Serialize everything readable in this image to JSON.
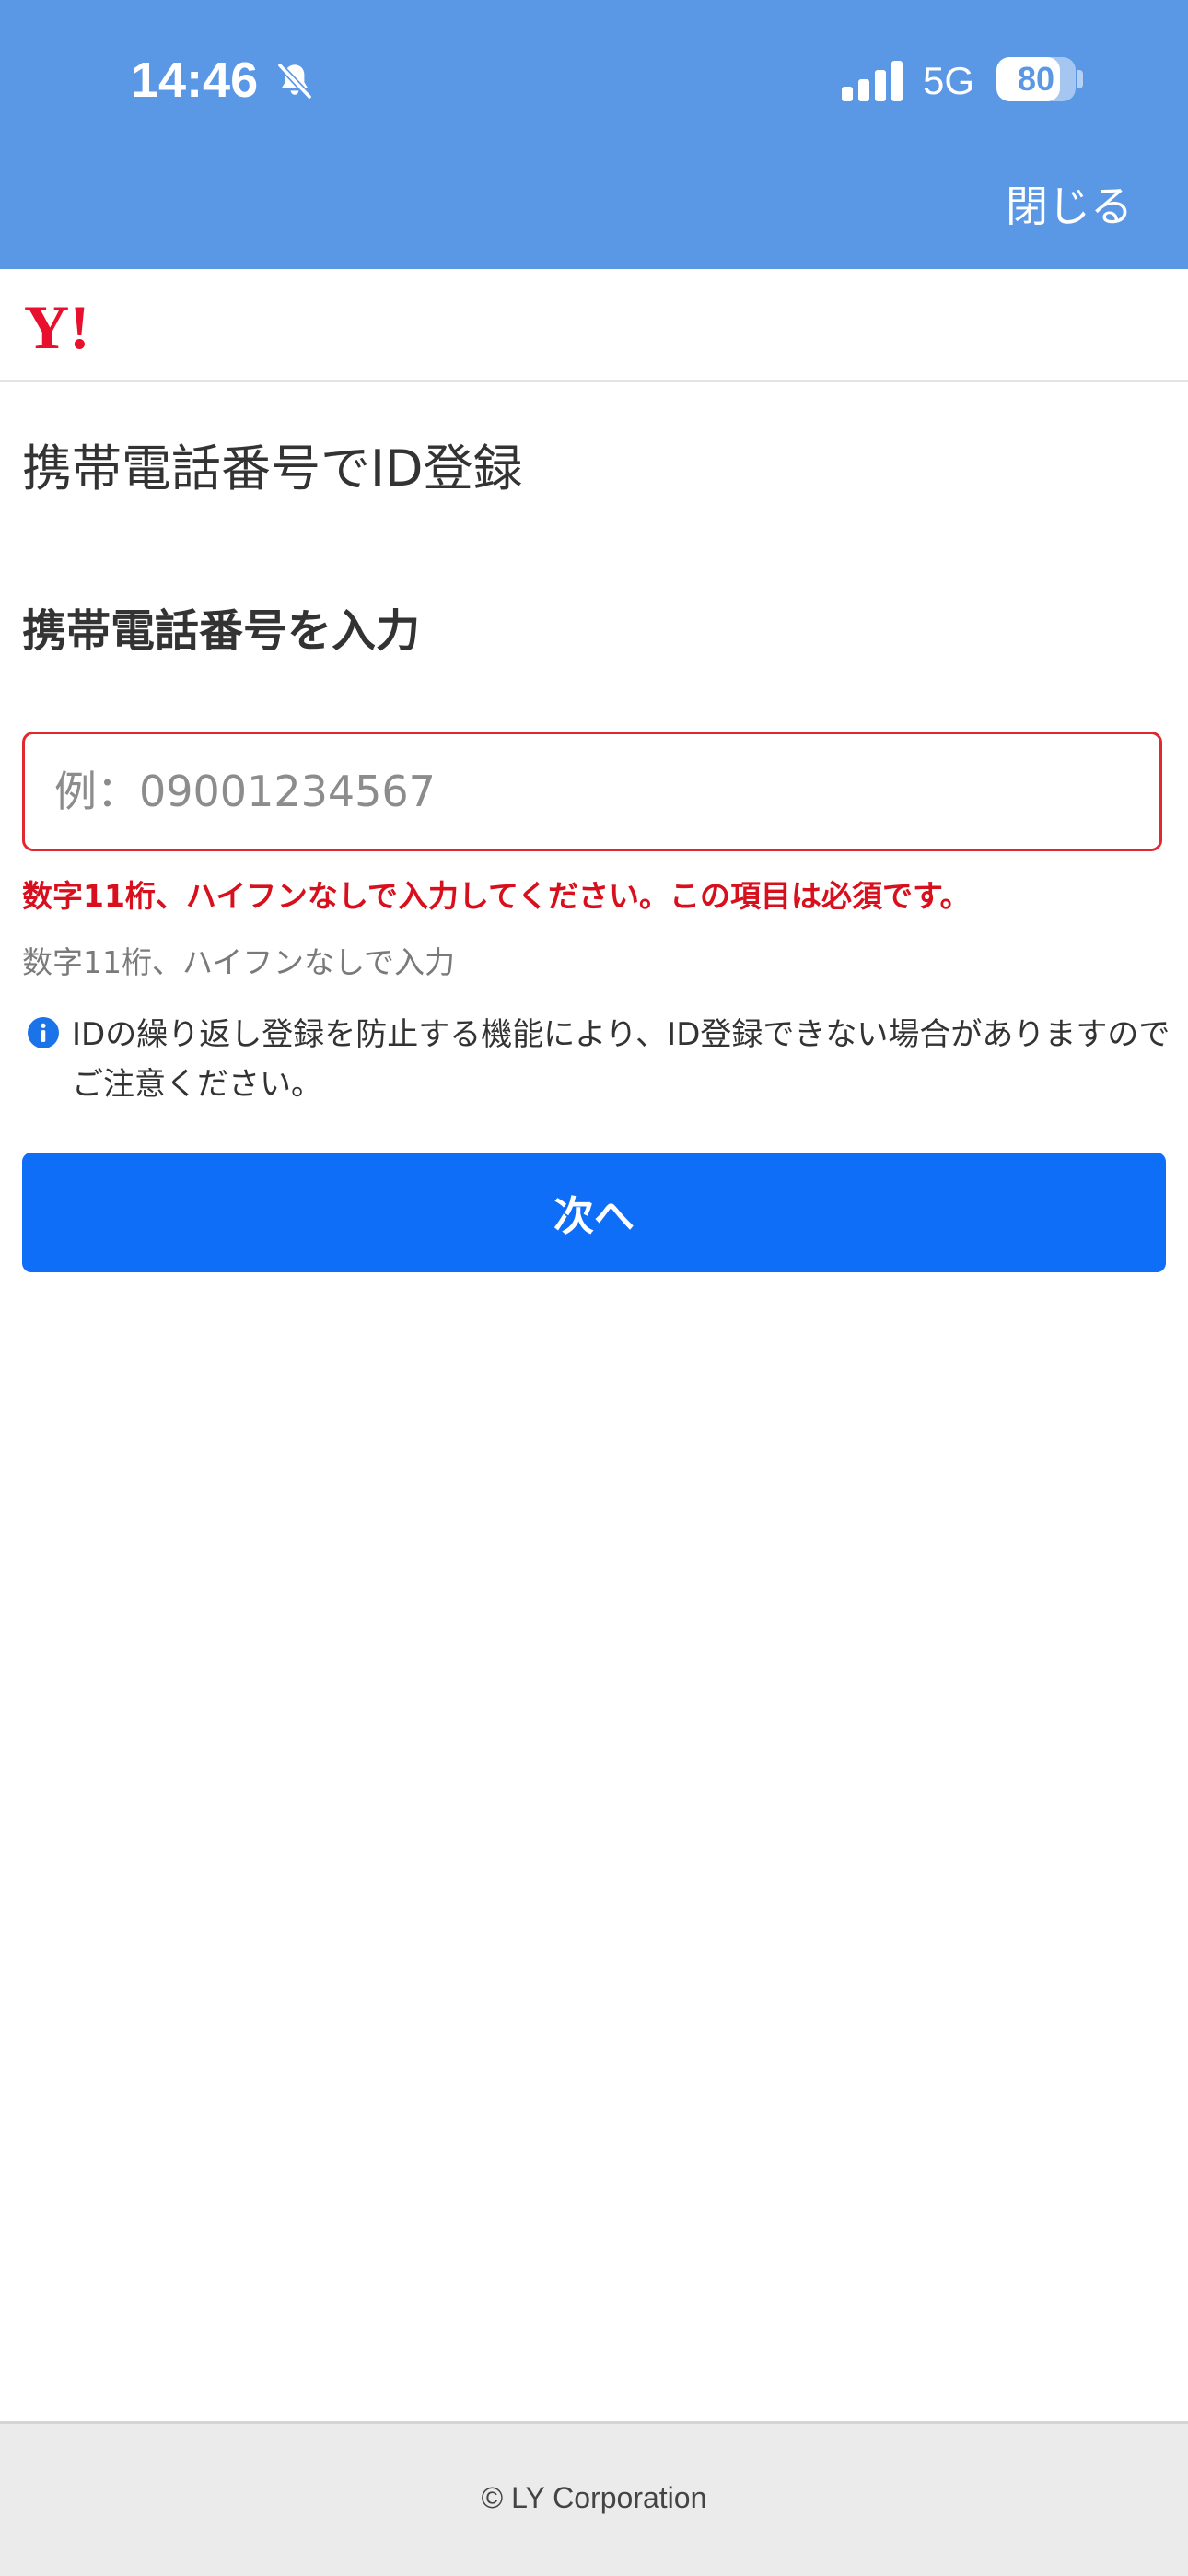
{
  "status_bar": {
    "time": "14:46",
    "network": "5G",
    "battery": "80",
    "battery_level": 0.8
  },
  "nav": {
    "close_label": "閉じる"
  },
  "header": {
    "logo_text": "Y!"
  },
  "page": {
    "title": "携帯電話番号でID登録",
    "section_heading": "携帯電話番号を入力"
  },
  "form": {
    "phone_value": "",
    "phone_placeholder": "例：09001234567",
    "error_message": "数字11桁、ハイフンなしで入力してください。この項目は必須です。",
    "hint": "数字11桁、ハイフンなしで入力",
    "notice": "IDの繰り返し登録を防止する機能により、ID登録できない場合がありますのでご注意ください。",
    "next_label": "次へ"
  },
  "footer": {
    "copyright": "© LY Corporation"
  },
  "colors": {
    "top_bar": "#5a97e4",
    "primary_button": "#0f6ef7",
    "error": "#d8101e",
    "logo_red": "#e8102c",
    "info_blue": "#1a73e8"
  }
}
